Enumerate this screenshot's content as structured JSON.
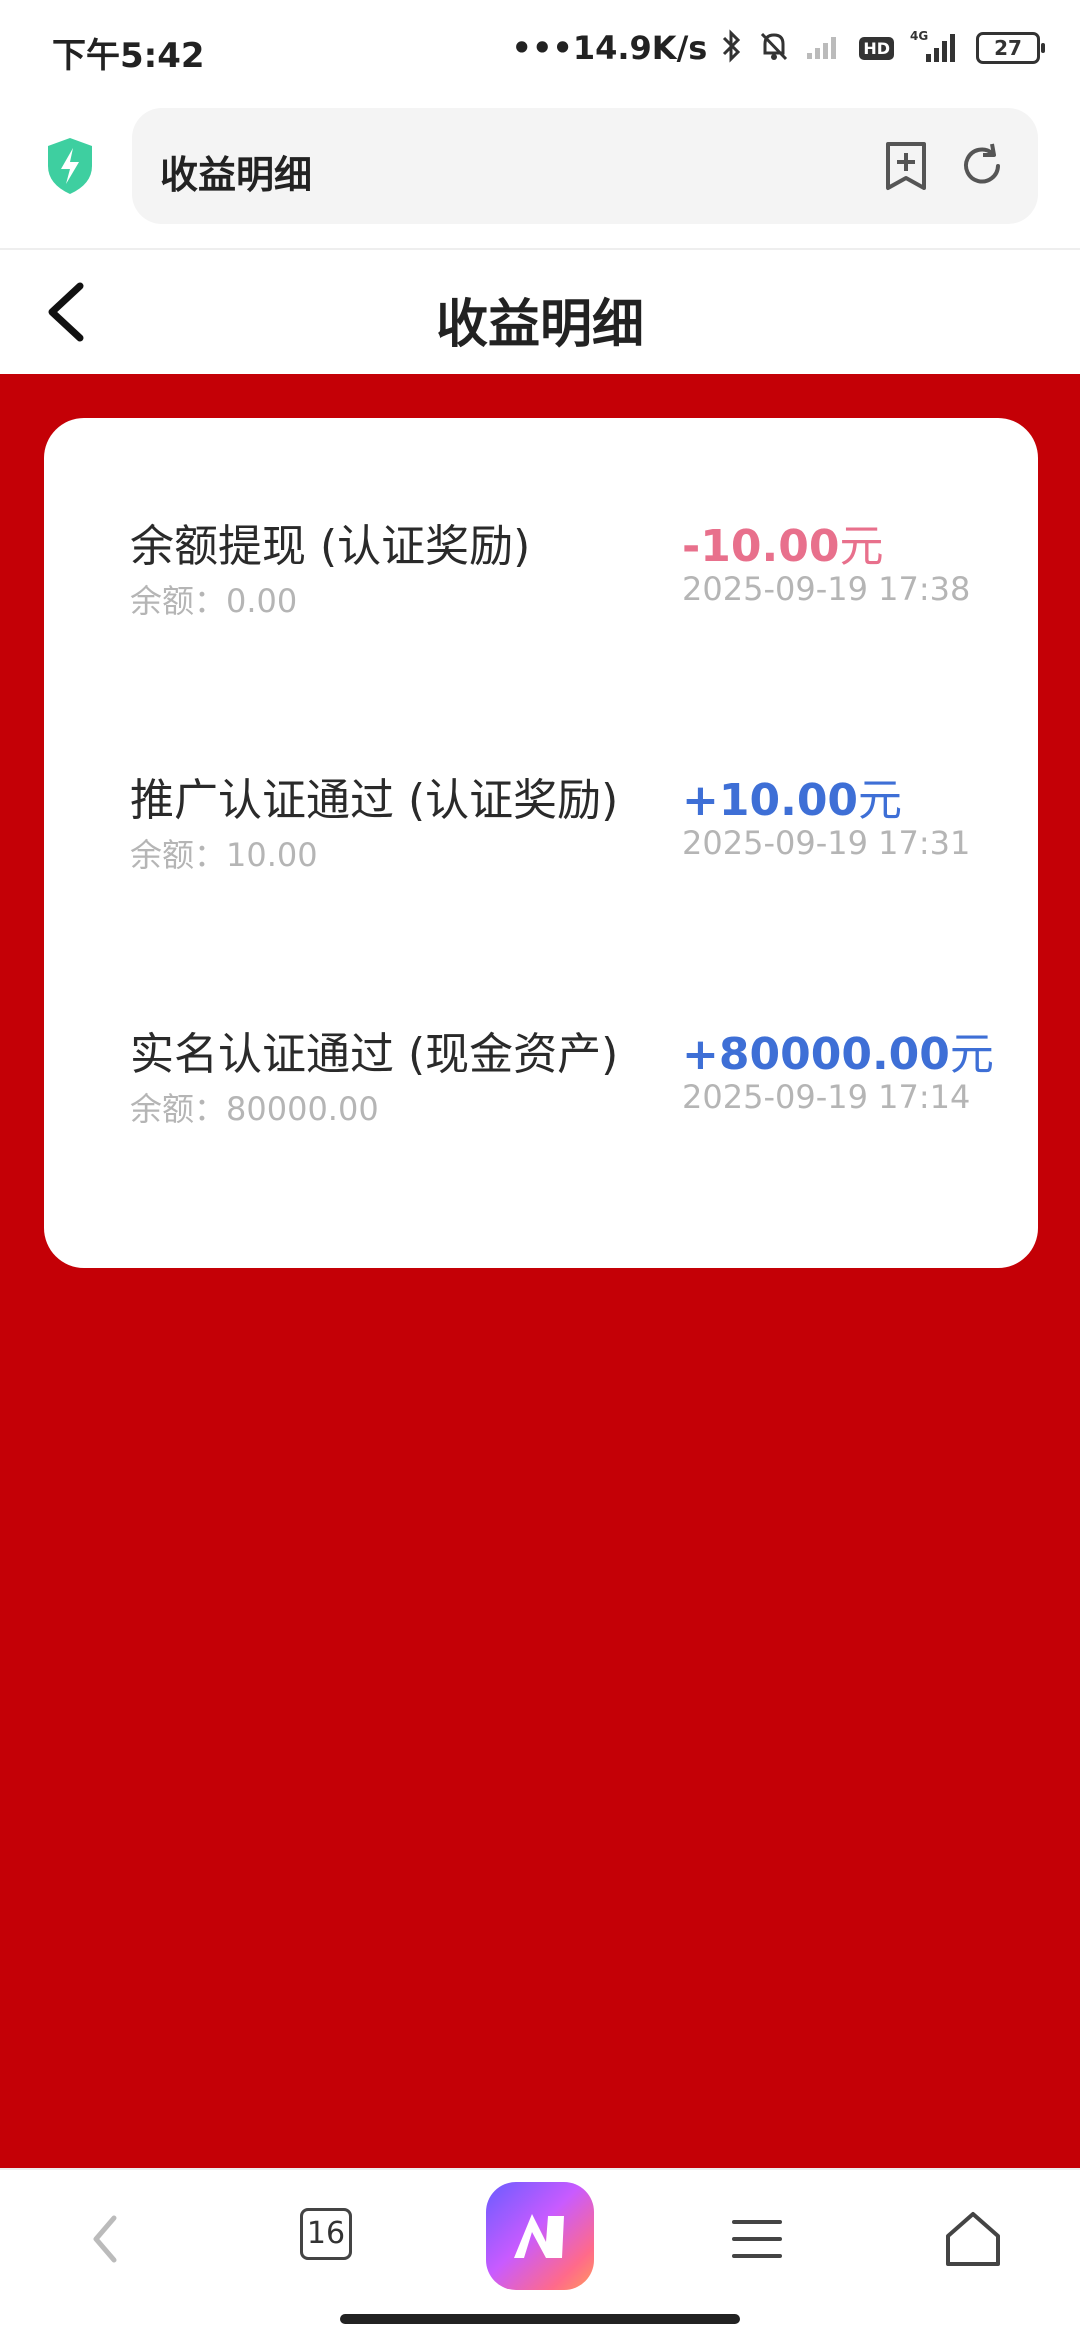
{
  "status_bar": {
    "time": "下午5:42",
    "network_speed": "•••14.9K/s",
    "hd_badge": "HD",
    "signal_label": "4G",
    "battery": "27"
  },
  "browser": {
    "url_text": "收益明细",
    "icons": [
      "shield-bolt-icon",
      "bookmark-add-icon",
      "refresh-icon"
    ]
  },
  "page": {
    "title": "收益明细"
  },
  "records": [
    {
      "title": "余额提现 (认证奖励)",
      "balance": "余额：0.00",
      "amount": "-10.00",
      "unit": "元",
      "time": "2025-09-19 17:38",
      "amount_color": "#e8708c"
    },
    {
      "title": "推广认证通过 (认证奖励)",
      "balance": "余额：10.00",
      "amount": "+10.00",
      "unit": "元",
      "time": "2025-09-19 17:31",
      "amount_color": "#3e6fd6"
    },
    {
      "title": "实名认证通过 (现金资产)",
      "balance": "余额：80000.00",
      "amount": "+80000.00",
      "unit": "元",
      "time": "2025-09-19 17:14",
      "amount_color": "#3e6fd6"
    }
  ],
  "bottom_nav": {
    "tab_count": "16",
    "icons": [
      "back-icon",
      "tabs-icon",
      "ai-assistant-icon",
      "menu-icon",
      "home-icon"
    ]
  },
  "colors": {
    "background": "#c40006",
    "card": "#ffffff"
  }
}
